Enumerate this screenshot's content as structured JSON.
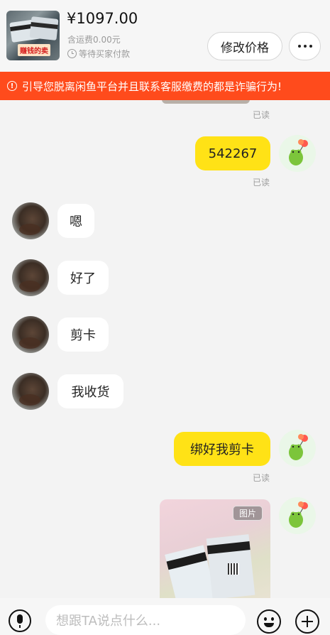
{
  "header": {
    "price": "¥1097.00",
    "shipping": "含运费0.00元",
    "status": "等待买家付款",
    "thumb_tag": "赚钱的卖",
    "modify_price_label": "修改价格"
  },
  "warning": {
    "icon": "exclamation-circle-icon",
    "text": "引导您脱离闲鱼平台并且联系客服缴费的都是诈骗行为!"
  },
  "messages": [
    {
      "sender": "self",
      "read": "已读"
    },
    {
      "sender": "self",
      "text": "542267",
      "read": "已读"
    },
    {
      "sender": "other",
      "text": "嗯"
    },
    {
      "sender": "other",
      "text": "好了"
    },
    {
      "sender": "other",
      "text": "剪卡"
    },
    {
      "sender": "other",
      "text": "我收货"
    },
    {
      "sender": "self",
      "text": "绑好我剪卡",
      "read": "已读"
    },
    {
      "sender": "self",
      "type": "image",
      "tag": "图片"
    }
  ],
  "input": {
    "placeholder": "想跟TA说点什么..."
  },
  "colors": {
    "warning_bg": "#ff4b1c",
    "own_bubble": "#ffe216",
    "other_bubble": "#ffffff",
    "background": "#f3f3f3"
  }
}
